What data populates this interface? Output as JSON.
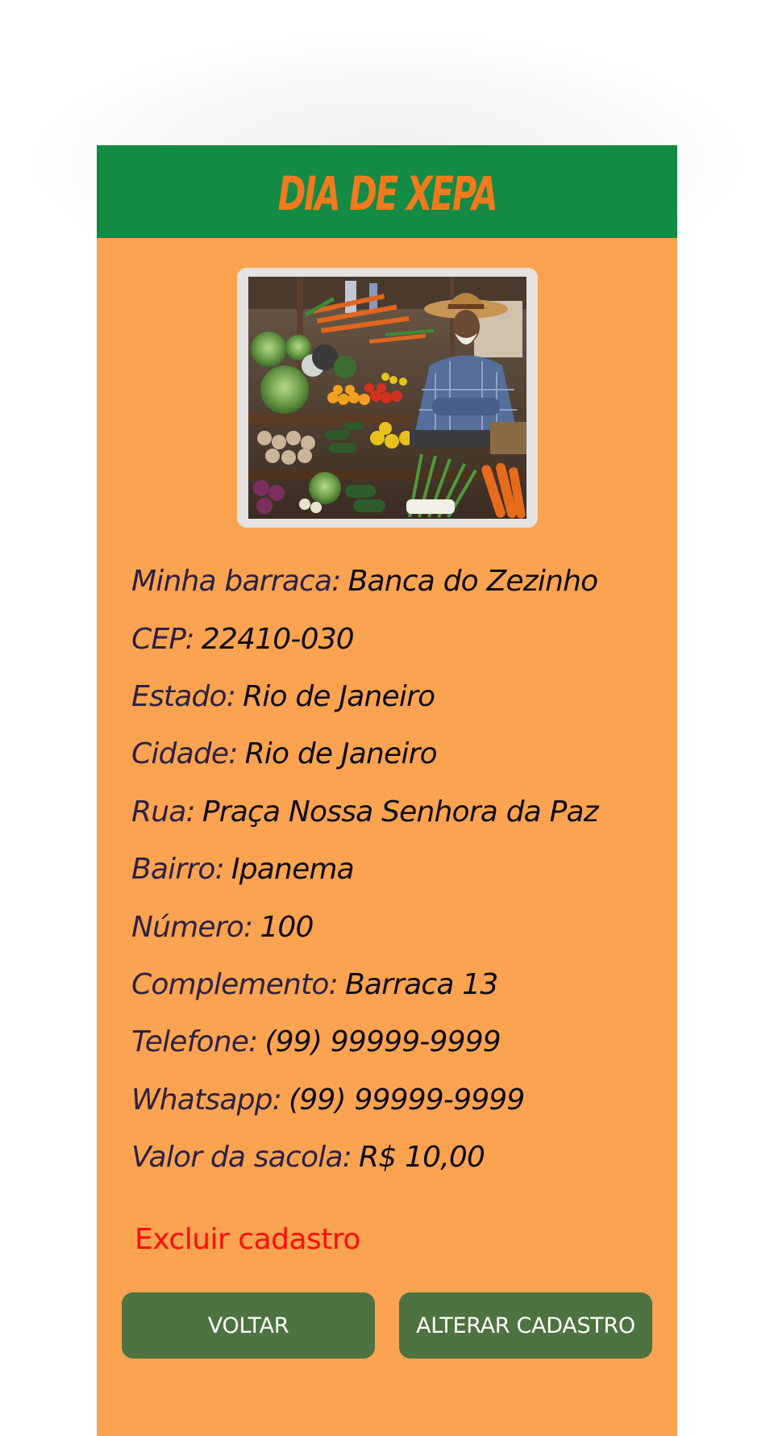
{
  "header": {
    "title": "DIA DE XEPA"
  },
  "stall_photo": {
    "description_icon": "market-vendor-photo"
  },
  "info": [
    {
      "label": "Minha barraca:",
      "value": "Banca do Zezinho"
    },
    {
      "label": "CEP:",
      "value": "22410-030"
    },
    {
      "label": "Estado:",
      "value": "Rio de Janeiro"
    },
    {
      "label": "Cidade:",
      "value": "Rio de Janeiro"
    },
    {
      "label": "Rua:",
      "value": "Praça Nossa Senhora da Paz"
    },
    {
      "label": "Bairro:",
      "value": "Ipanema"
    },
    {
      "label": "Número:",
      "value": "100"
    },
    {
      "label": "Complemento:",
      "value": "Barraca 13"
    },
    {
      "label": "Telefone:",
      "value": "(99) 99999-9999"
    },
    {
      "label": "Whatsapp:",
      "value": "(99) 99999-9999"
    },
    {
      "label": "Valor da sacola:",
      "value": "R$ 10,00"
    }
  ],
  "actions": {
    "delete_label": "Excluir cadastro",
    "back_label": "VOLTAR",
    "edit_label": "ALTERAR CADASTRO"
  },
  "colors": {
    "header_bg": "#138b45",
    "title": "#f27a1c",
    "card_bg": "#fba350",
    "button_bg": "#4f7241",
    "delete_text": "#ff0c0c"
  }
}
